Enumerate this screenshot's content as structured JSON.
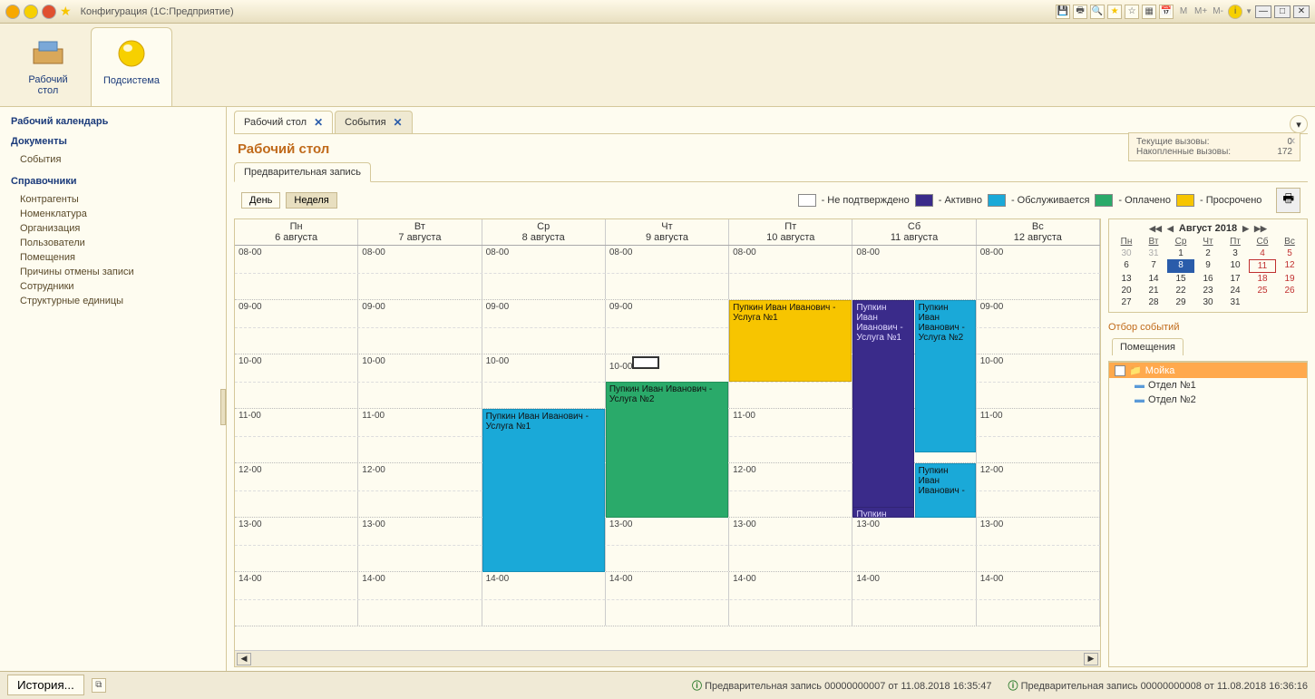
{
  "window": {
    "title": "Конфигурация  (1С:Предприятие)"
  },
  "titlebar_memory": {
    "m": "M",
    "mp": "M+",
    "mm": "M-"
  },
  "ribbon": {
    "tab1": {
      "label": "Рабочий\nстол"
    },
    "tab2": {
      "label": "Подсистема"
    }
  },
  "nav": {
    "title": "Рабочий календарь",
    "section_docs": "Документы",
    "docs_items": [
      "События"
    ],
    "section_refs": "Справочники",
    "refs_items": [
      "Контрагенты",
      "Номенклатура",
      "Организация",
      "Пользователи",
      "Помещения",
      "Причины отмены записи",
      "Сотрудники",
      "Структурные единицы"
    ]
  },
  "tabs": {
    "t1": {
      "label": "Рабочий стол"
    },
    "t2": {
      "label": "События"
    }
  },
  "panel": {
    "title": "Рабочий стол",
    "subtab": "Предварительная запись"
  },
  "notification": {
    "line1_label": "Текущие вызовы:",
    "line1_val": "0",
    "line2_label": "Накопленные вызовы:",
    "line2_val": "172"
  },
  "viewmode": {
    "day": "День",
    "week": "Неделя"
  },
  "legend": {
    "unconfirmed": "- Не подтверждено",
    "active": "- Активно",
    "serving": "- Обслуживается",
    "paid": "- Оплачено",
    "overdue": "- Просрочено"
  },
  "colors": {
    "unconfirmed": "#ffffff",
    "active": "#3a2b8a",
    "serving": "#1aa9d8",
    "paid": "#2aaa6a",
    "overdue": "#f7c500"
  },
  "calendar": {
    "days": [
      {
        "dow": "Пн",
        "date": "6 августа"
      },
      {
        "dow": "Вт",
        "date": "7 августа"
      },
      {
        "dow": "Ср",
        "date": "8 августа"
      },
      {
        "dow": "Чт",
        "date": "9 августа"
      },
      {
        "dow": "Пт",
        "date": "10 августа"
      },
      {
        "dow": "Сб",
        "date": "11 августа"
      },
      {
        "dow": "Вс",
        "date": "12 августа"
      }
    ],
    "hours": [
      "08-00",
      "09-00",
      "10-00",
      "11-00",
      "12-00",
      "13-00",
      "14-00"
    ],
    "events": [
      {
        "day": 2,
        "start": 3,
        "span": 3.0,
        "text": "Пупкин Иван Иванович - Услуга №1",
        "color": "#1aa9d8"
      },
      {
        "day": 3,
        "start": 2.5,
        "span": 2.5,
        "text": "Пупкин Иван Иванович - Услуга №2",
        "color": "#2aaa6a"
      },
      {
        "day": 4,
        "start": 1,
        "span": 1.5,
        "text": "Пупкин Иван Иванович - Услуга №1",
        "color": "#f7c500"
      },
      {
        "day": 5,
        "start": 1,
        "span": 3.9,
        "text": "Пупкин Иван Иванович - Услуга №1",
        "half": "left",
        "color": "#3a2b8a",
        "light": true
      },
      {
        "day": 5,
        "start": 4.8,
        "span": 0.2,
        "text": "Пупкин",
        "half": "left",
        "color": "#3a2b8a",
        "light": true
      },
      {
        "day": 5,
        "start": 1,
        "span": 2.8,
        "text": "Пупкин Иван Иванович - Услуга №2",
        "half": "right",
        "color": "#1aa9d8"
      },
      {
        "day": 5,
        "start": 4,
        "span": 1.0,
        "text": "Пупкин Иван Иванович - ",
        "half": "right",
        "color": "#1aa9d8"
      }
    ]
  },
  "minical": {
    "title": "Август 2018",
    "dow": [
      "Пн",
      "Вт",
      "Ср",
      "Чт",
      "Пт",
      "Сб",
      "Вс"
    ],
    "weeks": [
      [
        {
          "d": "30",
          "o": true
        },
        {
          "d": "31",
          "o": true
        },
        {
          "d": "1"
        },
        {
          "d": "2"
        },
        {
          "d": "3"
        },
        {
          "d": "4",
          "w": true
        },
        {
          "d": "5",
          "w": true
        }
      ],
      [
        {
          "d": "6"
        },
        {
          "d": "7"
        },
        {
          "d": "8",
          "sel": true
        },
        {
          "d": "9"
        },
        {
          "d": "10"
        },
        {
          "d": "11",
          "w": true,
          "t": true
        },
        {
          "d": "12",
          "w": true
        }
      ],
      [
        {
          "d": "13"
        },
        {
          "d": "14"
        },
        {
          "d": "15"
        },
        {
          "d": "16"
        },
        {
          "d": "17"
        },
        {
          "d": "18",
          "w": true
        },
        {
          "d": "19",
          "w": true
        }
      ],
      [
        {
          "d": "20"
        },
        {
          "d": "21"
        },
        {
          "d": "22"
        },
        {
          "d": "23"
        },
        {
          "d": "24"
        },
        {
          "d": "25",
          "w": true
        },
        {
          "d": "26",
          "w": true
        }
      ],
      [
        {
          "d": "27"
        },
        {
          "d": "28"
        },
        {
          "d": "29"
        },
        {
          "d": "30"
        },
        {
          "d": "31"
        },
        {
          "d": "",
          "o": true
        },
        {
          "d": "",
          "o": true
        }
      ]
    ]
  },
  "filter": {
    "title": "Отбор событий",
    "tab": "Помещения",
    "root": "Мойка",
    "children": [
      "Отдел №1",
      "Отдел №2"
    ]
  },
  "statusbar": {
    "history": "История...",
    "msg1": "Предварительная запись 00000000007 от 11.08.2018 16:35:47",
    "msg2": "Предварительная запись 00000000008 от 11.08.2018 16:36:16"
  }
}
